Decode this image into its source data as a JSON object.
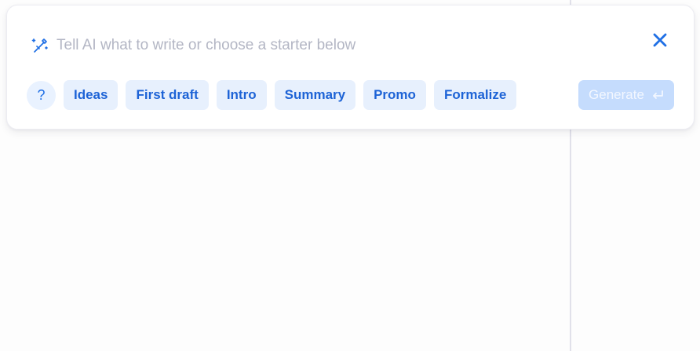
{
  "colors": {
    "accent": "#1f6fe5",
    "chip_bg": "#e7f0fd",
    "chip_text": "#1d63d6",
    "placeholder": "#b3b6c4",
    "generate_disabled_bg": "#c5dcfd"
  },
  "prompt": {
    "icon": "magic-wand-icon",
    "placeholder": "Tell AI what to write or choose a starter below",
    "value": ""
  },
  "close": {
    "icon": "close-icon"
  },
  "help": {
    "label": "?"
  },
  "starters": [
    {
      "label": "Ideas"
    },
    {
      "label": "First draft"
    },
    {
      "label": "Intro"
    },
    {
      "label": "Summary"
    },
    {
      "label": "Promo"
    },
    {
      "label": "Formalize"
    }
  ],
  "generate": {
    "label": "Generate",
    "icon": "enter-icon",
    "state": "disabled"
  }
}
